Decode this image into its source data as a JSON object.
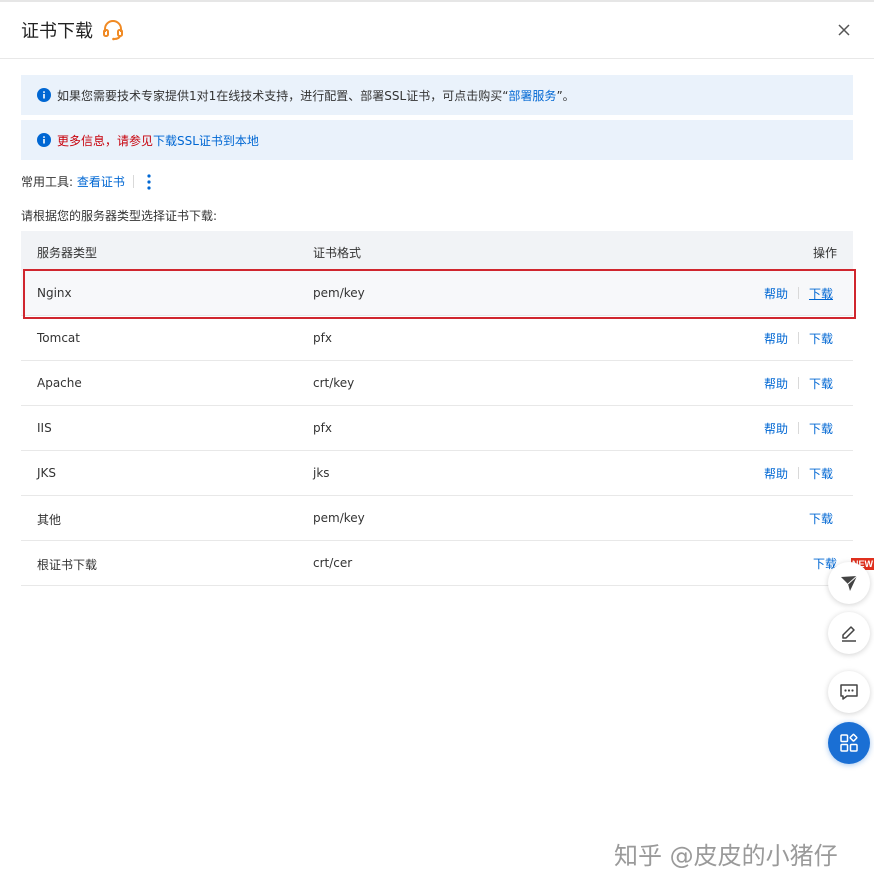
{
  "dialog": {
    "title": "证书下载",
    "notice1": {
      "text": "如果您需要技术专家提供1对1在线技术支持，进行配置、部署SSL证书，可点击购买“",
      "link": "部署服务",
      "suffix": "”。"
    },
    "notice2": {
      "text": "更多信息，请参见",
      "link": "下载SSL证书到本地"
    },
    "tools": {
      "label": "常用工具:",
      "link": "查看证书"
    },
    "instruction": "请根据您的服务器类型选择证书下载:"
  },
  "table": {
    "headers": [
      "服务器类型",
      "证书格式",
      "操作"
    ],
    "help_label": "帮助",
    "download_label": "下载",
    "rows": [
      {
        "server": "Nginx",
        "format": "pem/key"
      },
      {
        "server": "Tomcat",
        "format": "pfx"
      },
      {
        "server": "Apache",
        "format": "crt/key"
      },
      {
        "server": "IIS",
        "format": "pfx"
      },
      {
        "server": "JKS",
        "format": "jks"
      },
      {
        "server": "其他",
        "format": "pem/key"
      },
      {
        "server": "根证书下载",
        "format": "crt/cer"
      }
    ]
  },
  "floating": {
    "badge": "NEW"
  },
  "watermark": "知乎 @皮皮的小猪仔",
  "colors": {
    "accent": "#0067d3",
    "alert": "#c7000b",
    "highlight_border": "#d0262e",
    "notice_bg": "#eaf2fb",
    "headset": "#f08a24",
    "float_blue": "#1a6fd4"
  },
  "icons": {
    "title": "headset-icon",
    "close": "close-icon",
    "notice": "info-icon",
    "more": "kebab-icon",
    "floating": [
      "paper-plane-icon",
      "edit-icon",
      "chat-icon",
      "apps-icon"
    ]
  }
}
